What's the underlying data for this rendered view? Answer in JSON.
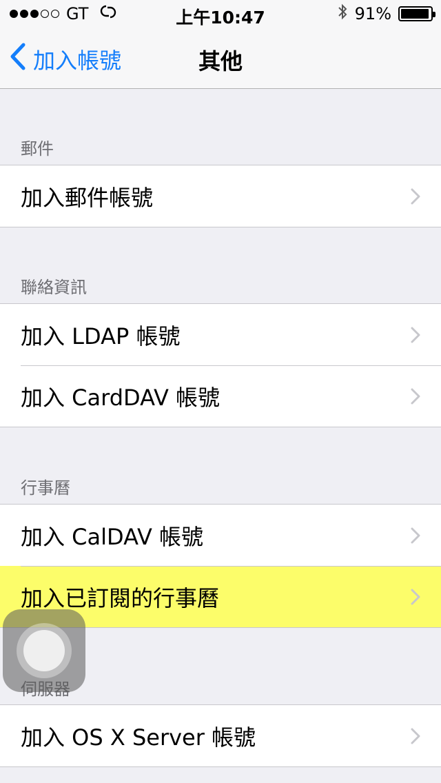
{
  "status_bar": {
    "signal_bars_filled": 3,
    "signal_bars_total": 5,
    "carrier": "GT",
    "network_icon": "chain-link-icon",
    "time": "上午10:47",
    "bluetooth_icon": "bluetooth-icon",
    "battery_percent": "91%",
    "battery_level": 0.91
  },
  "nav": {
    "back_label": "加入帳號",
    "title": "其他"
  },
  "sections": [
    {
      "header": "郵件",
      "items": [
        "加入郵件帳號"
      ]
    },
    {
      "header": "聯絡資訊",
      "items": [
        "加入 LDAP 帳號",
        "加入 CardDAV 帳號"
      ]
    },
    {
      "header": "行事曆",
      "items": [
        "加入 CalDAV 帳號",
        "加入已訂閱的行事曆"
      ]
    },
    {
      "header": "伺服器",
      "items": [
        "加入 OS X Server 帳號"
      ]
    }
  ],
  "highlighted_item": "加入已訂閱的行事曆",
  "colors": {
    "accent": "#147efb",
    "highlight": "#fcfd6a",
    "background": "#efeff4",
    "section_header": "#6d6d72",
    "chevron": "#c7c7cc"
  }
}
